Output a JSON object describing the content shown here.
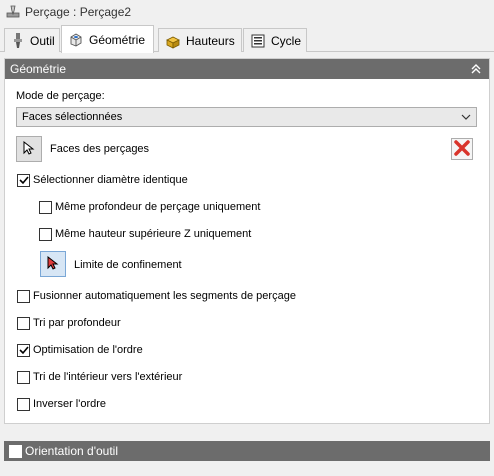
{
  "window": {
    "title": "Perçage : Perçage2"
  },
  "tabs": [
    {
      "label": "Outil",
      "icon": "tool-icon",
      "active": false
    },
    {
      "label": "Géométrie",
      "icon": "geometry-icon",
      "active": true
    },
    {
      "label": "Hauteurs",
      "icon": "heights-icon",
      "active": false
    },
    {
      "label": "Cycle",
      "icon": "cycle-icon",
      "active": false
    }
  ],
  "geometry": {
    "header": "Géométrie",
    "mode_label": "Mode de perçage:",
    "mode_value": "Faces sélectionnées",
    "faces_label": "Faces des perçages",
    "select_same_diameter": {
      "label": "Sélectionner diamètre identique",
      "checked": true
    },
    "same_depth_only": {
      "label": "Même profondeur de perçage uniquement",
      "checked": false
    },
    "same_top_height_only": {
      "label": "Même hauteur supérieure Z uniquement",
      "checked": false
    },
    "confinement_label": "Limite de confinement",
    "merge_segments": {
      "label": "Fusionner automatiquement les segments de perçage",
      "checked": false
    },
    "sort_by_depth": {
      "label": "Tri par profondeur",
      "checked": false
    },
    "optimize_order": {
      "label": "Optimisation de l'ordre",
      "checked": true
    },
    "sort_inside_out": {
      "label": "Tri de l'intérieur vers l'extérieur",
      "checked": false
    },
    "reverse_order": {
      "label": "Inverser l'ordre",
      "checked": false
    }
  },
  "tool_orientation": {
    "label": "Orientation d'outil",
    "checked": false
  },
  "colors": {
    "header_bg": "#6c6c6c",
    "delete_red": "#d9342b",
    "accent_blue": "#2a6fc9"
  }
}
